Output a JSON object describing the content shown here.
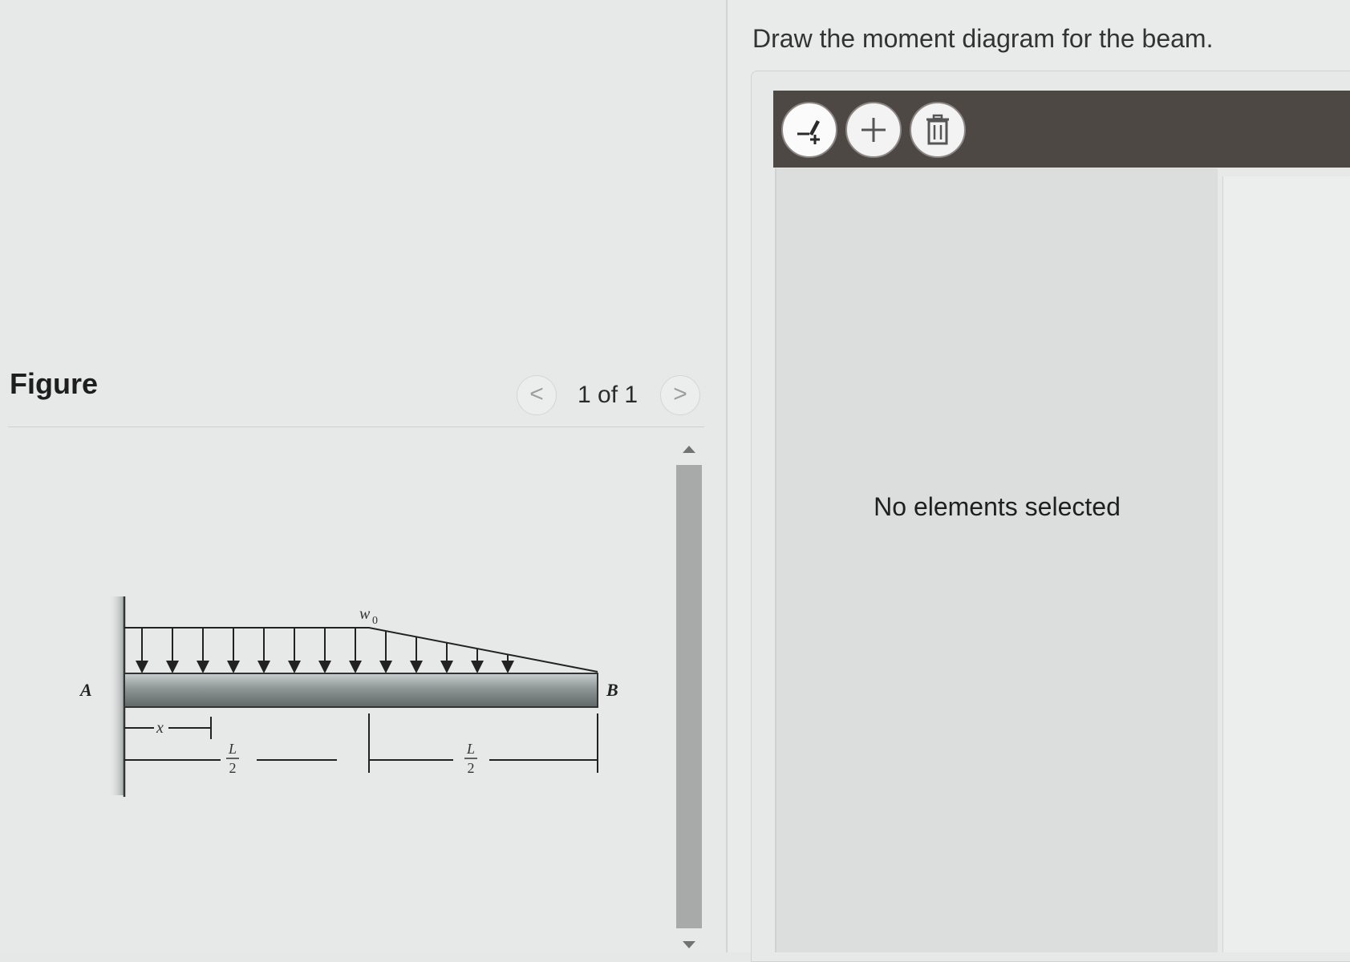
{
  "figure": {
    "title": "Figure",
    "counter": "1 of 1",
    "prev_icon": "chevron-left-icon",
    "next_icon": "chevron-right-icon",
    "prev_glyph": "<",
    "next_glyph": ">",
    "labels": {
      "support_a": "A",
      "end_b": "B",
      "load": "w",
      "load_sub": "0",
      "x": "x",
      "half_num": "L",
      "half_den": "2"
    }
  },
  "question": {
    "text": "Draw the moment diagram for the beam."
  },
  "toolbar": {
    "tools": [
      {
        "name": "draw-tool-button",
        "icon": "pencil-plus-icon"
      },
      {
        "name": "add-button",
        "icon": "plus-icon"
      },
      {
        "name": "delete-button",
        "icon": "trash-icon"
      }
    ]
  },
  "canvas": {
    "status": "No elements selected"
  },
  "colors": {
    "toolbar_bg": "#4e4845",
    "scroll_thumb": "#a8aaa9",
    "beam": "#8e9696"
  }
}
